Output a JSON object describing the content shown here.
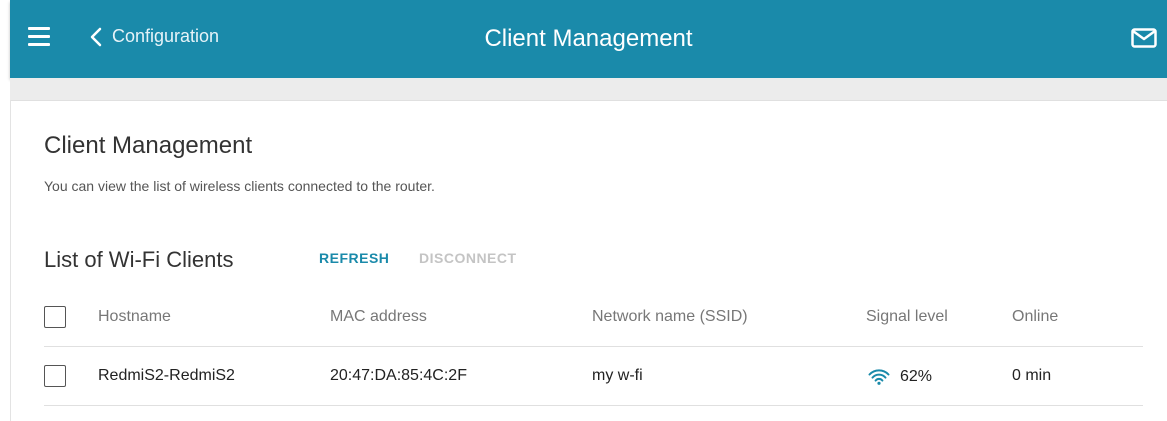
{
  "header": {
    "back_label": "Configuration",
    "title": "Client Management",
    "bar_color": "#1a8aaa"
  },
  "section": {
    "title": "Client Management",
    "description": "You can view the list of wireless clients connected to the router."
  },
  "clients": {
    "title": "List of Wi-Fi Clients",
    "refresh_label": "REFRESH",
    "disconnect_label": "DISCONNECT",
    "columns": [
      "Hostname",
      "MAC address",
      "Network name (SSID)",
      "Signal level",
      "Online"
    ],
    "rows": [
      {
        "hostname": "RedmiS2-RedmiS2",
        "mac": "20:47:DA:85:4C:2F",
        "ssid": "my w-fi",
        "signal": "62%",
        "online": "0 min"
      }
    ]
  },
  "icons": {
    "menu": "hamburger-menu-icon",
    "back": "chevron-left-icon",
    "mail": "envelope-icon",
    "signal": "wifi-signal-icon"
  }
}
